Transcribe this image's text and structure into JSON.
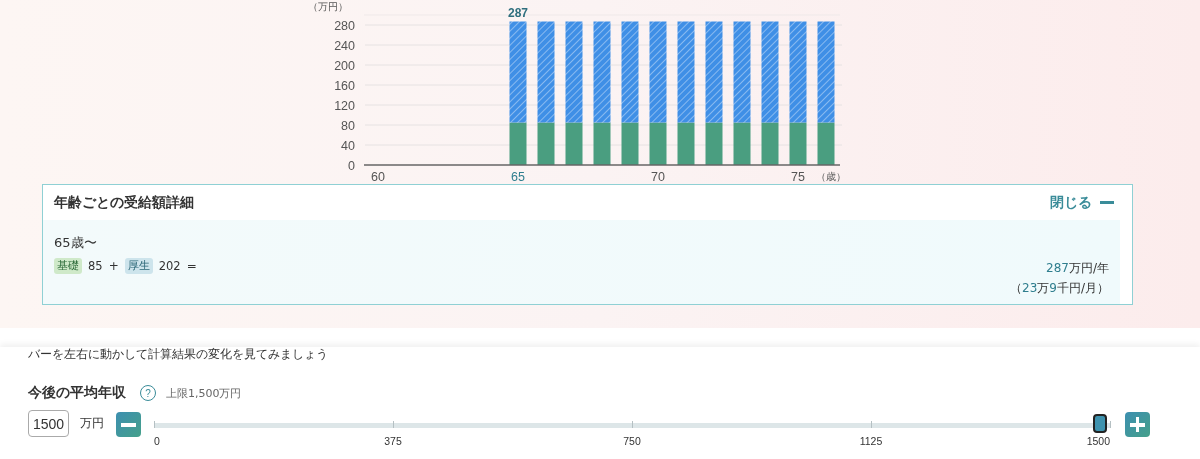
{
  "chart": {
    "chart_data": {
      "type": "bar",
      "stacked": true,
      "ylabel": "（万円）",
      "xlabel": "（歳）",
      "x": [
        60,
        61,
        62,
        63,
        64,
        65,
        66,
        67,
        68,
        69,
        70,
        71,
        72,
        73,
        74,
        75,
        76
      ],
      "series": [
        {
          "color": "#4a9e80",
          "values": [
            0,
            0,
            0,
            0,
            0,
            85,
            85,
            85,
            85,
            85,
            85,
            85,
            85,
            85,
            85,
            85,
            85
          ]
        },
        {
          "color": "#3f8fe6",
          "values": [
            0,
            0,
            0,
            0,
            0,
            202,
            202,
            202,
            202,
            202,
            202,
            202,
            202,
            202,
            202,
            202,
            202
          ]
        }
      ],
      "xlim": [
        59.5,
        76.5
      ],
      "ylim": [
        0,
        300
      ],
      "yticks": [
        0,
        40,
        80,
        120,
        160,
        200,
        240,
        280
      ],
      "xticks": [
        60,
        65,
        70,
        75
      ],
      "grid": true,
      "annotations": [
        {
          "x": 65,
          "y": 287,
          "text": "287"
        }
      ]
    }
  },
  "detail": {
    "title": "年齢ごとの受給額詳細",
    "close_label": "閉じる",
    "expanded": true,
    "rows": [
      {
        "age": "65歳〜",
        "parts": [
          {
            "kind": "kiso",
            "tag": "基礎",
            "amount": "85"
          },
          {
            "kind": "kosei",
            "tag": "厚生",
            "amount": "202"
          }
        ],
        "plus": "+",
        "equals": "=",
        "annual_value": "287",
        "annual_unit": "万円/年",
        "monthly_open": "（",
        "monthly_man": "23",
        "monthly_man_unit": "万",
        "monthly_sen": "9",
        "monthly_rest": "千円/月）"
      }
    ]
  },
  "controls": {
    "hint": "バーを左右に動かして計算結果の変化を見てみましょう",
    "slider": {
      "label": "今後の平均年収",
      "help": "?",
      "limit": "上限1,500万円",
      "value": "1500",
      "unit": "万円",
      "level": 1,
      "ticks": [
        "0",
        "375",
        "750",
        "1125",
        "1500"
      ]
    }
  }
}
